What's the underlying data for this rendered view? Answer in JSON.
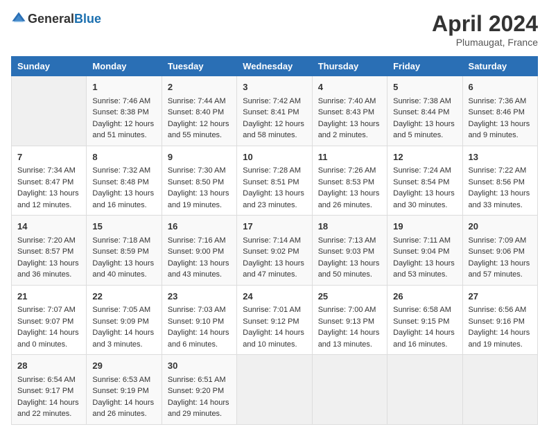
{
  "header": {
    "logo_general": "General",
    "logo_blue": "Blue",
    "title": "April 2024",
    "subtitle": "Plumaugat, France"
  },
  "weekdays": [
    "Sunday",
    "Monday",
    "Tuesday",
    "Wednesday",
    "Thursday",
    "Friday",
    "Saturday"
  ],
  "weeks": [
    [
      {
        "day": "",
        "sunrise": "",
        "sunset": "",
        "daylight": ""
      },
      {
        "day": "1",
        "sunrise": "Sunrise: 7:46 AM",
        "sunset": "Sunset: 8:38 PM",
        "daylight": "Daylight: 12 hours and 51 minutes."
      },
      {
        "day": "2",
        "sunrise": "Sunrise: 7:44 AM",
        "sunset": "Sunset: 8:40 PM",
        "daylight": "Daylight: 12 hours and 55 minutes."
      },
      {
        "day": "3",
        "sunrise": "Sunrise: 7:42 AM",
        "sunset": "Sunset: 8:41 PM",
        "daylight": "Daylight: 12 hours and 58 minutes."
      },
      {
        "day": "4",
        "sunrise": "Sunrise: 7:40 AM",
        "sunset": "Sunset: 8:43 PM",
        "daylight": "Daylight: 13 hours and 2 minutes."
      },
      {
        "day": "5",
        "sunrise": "Sunrise: 7:38 AM",
        "sunset": "Sunset: 8:44 PM",
        "daylight": "Daylight: 13 hours and 5 minutes."
      },
      {
        "day": "6",
        "sunrise": "Sunrise: 7:36 AM",
        "sunset": "Sunset: 8:46 PM",
        "daylight": "Daylight: 13 hours and 9 minutes."
      }
    ],
    [
      {
        "day": "7",
        "sunrise": "Sunrise: 7:34 AM",
        "sunset": "Sunset: 8:47 PM",
        "daylight": "Daylight: 13 hours and 12 minutes."
      },
      {
        "day": "8",
        "sunrise": "Sunrise: 7:32 AM",
        "sunset": "Sunset: 8:48 PM",
        "daylight": "Daylight: 13 hours and 16 minutes."
      },
      {
        "day": "9",
        "sunrise": "Sunrise: 7:30 AM",
        "sunset": "Sunset: 8:50 PM",
        "daylight": "Daylight: 13 hours and 19 minutes."
      },
      {
        "day": "10",
        "sunrise": "Sunrise: 7:28 AM",
        "sunset": "Sunset: 8:51 PM",
        "daylight": "Daylight: 13 hours and 23 minutes."
      },
      {
        "day": "11",
        "sunrise": "Sunrise: 7:26 AM",
        "sunset": "Sunset: 8:53 PM",
        "daylight": "Daylight: 13 hours and 26 minutes."
      },
      {
        "day": "12",
        "sunrise": "Sunrise: 7:24 AM",
        "sunset": "Sunset: 8:54 PM",
        "daylight": "Daylight: 13 hours and 30 minutes."
      },
      {
        "day": "13",
        "sunrise": "Sunrise: 7:22 AM",
        "sunset": "Sunset: 8:56 PM",
        "daylight": "Daylight: 13 hours and 33 minutes."
      }
    ],
    [
      {
        "day": "14",
        "sunrise": "Sunrise: 7:20 AM",
        "sunset": "Sunset: 8:57 PM",
        "daylight": "Daylight: 13 hours and 36 minutes."
      },
      {
        "day": "15",
        "sunrise": "Sunrise: 7:18 AM",
        "sunset": "Sunset: 8:59 PM",
        "daylight": "Daylight: 13 hours and 40 minutes."
      },
      {
        "day": "16",
        "sunrise": "Sunrise: 7:16 AM",
        "sunset": "Sunset: 9:00 PM",
        "daylight": "Daylight: 13 hours and 43 minutes."
      },
      {
        "day": "17",
        "sunrise": "Sunrise: 7:14 AM",
        "sunset": "Sunset: 9:02 PM",
        "daylight": "Daylight: 13 hours and 47 minutes."
      },
      {
        "day": "18",
        "sunrise": "Sunrise: 7:13 AM",
        "sunset": "Sunset: 9:03 PM",
        "daylight": "Daylight: 13 hours and 50 minutes."
      },
      {
        "day": "19",
        "sunrise": "Sunrise: 7:11 AM",
        "sunset": "Sunset: 9:04 PM",
        "daylight": "Daylight: 13 hours and 53 minutes."
      },
      {
        "day": "20",
        "sunrise": "Sunrise: 7:09 AM",
        "sunset": "Sunset: 9:06 PM",
        "daylight": "Daylight: 13 hours and 57 minutes."
      }
    ],
    [
      {
        "day": "21",
        "sunrise": "Sunrise: 7:07 AM",
        "sunset": "Sunset: 9:07 PM",
        "daylight": "Daylight: 14 hours and 0 minutes."
      },
      {
        "day": "22",
        "sunrise": "Sunrise: 7:05 AM",
        "sunset": "Sunset: 9:09 PM",
        "daylight": "Daylight: 14 hours and 3 minutes."
      },
      {
        "day": "23",
        "sunrise": "Sunrise: 7:03 AM",
        "sunset": "Sunset: 9:10 PM",
        "daylight": "Daylight: 14 hours and 6 minutes."
      },
      {
        "day": "24",
        "sunrise": "Sunrise: 7:01 AM",
        "sunset": "Sunset: 9:12 PM",
        "daylight": "Daylight: 14 hours and 10 minutes."
      },
      {
        "day": "25",
        "sunrise": "Sunrise: 7:00 AM",
        "sunset": "Sunset: 9:13 PM",
        "daylight": "Daylight: 14 hours and 13 minutes."
      },
      {
        "day": "26",
        "sunrise": "Sunrise: 6:58 AM",
        "sunset": "Sunset: 9:15 PM",
        "daylight": "Daylight: 14 hours and 16 minutes."
      },
      {
        "day": "27",
        "sunrise": "Sunrise: 6:56 AM",
        "sunset": "Sunset: 9:16 PM",
        "daylight": "Daylight: 14 hours and 19 minutes."
      }
    ],
    [
      {
        "day": "28",
        "sunrise": "Sunrise: 6:54 AM",
        "sunset": "Sunset: 9:17 PM",
        "daylight": "Daylight: 14 hours and 22 minutes."
      },
      {
        "day": "29",
        "sunrise": "Sunrise: 6:53 AM",
        "sunset": "Sunset: 9:19 PM",
        "daylight": "Daylight: 14 hours and 26 minutes."
      },
      {
        "day": "30",
        "sunrise": "Sunrise: 6:51 AM",
        "sunset": "Sunset: 9:20 PM",
        "daylight": "Daylight: 14 hours and 29 minutes."
      },
      {
        "day": "",
        "sunrise": "",
        "sunset": "",
        "daylight": ""
      },
      {
        "day": "",
        "sunrise": "",
        "sunset": "",
        "daylight": ""
      },
      {
        "day": "",
        "sunrise": "",
        "sunset": "",
        "daylight": ""
      },
      {
        "day": "",
        "sunrise": "",
        "sunset": "",
        "daylight": ""
      }
    ]
  ]
}
